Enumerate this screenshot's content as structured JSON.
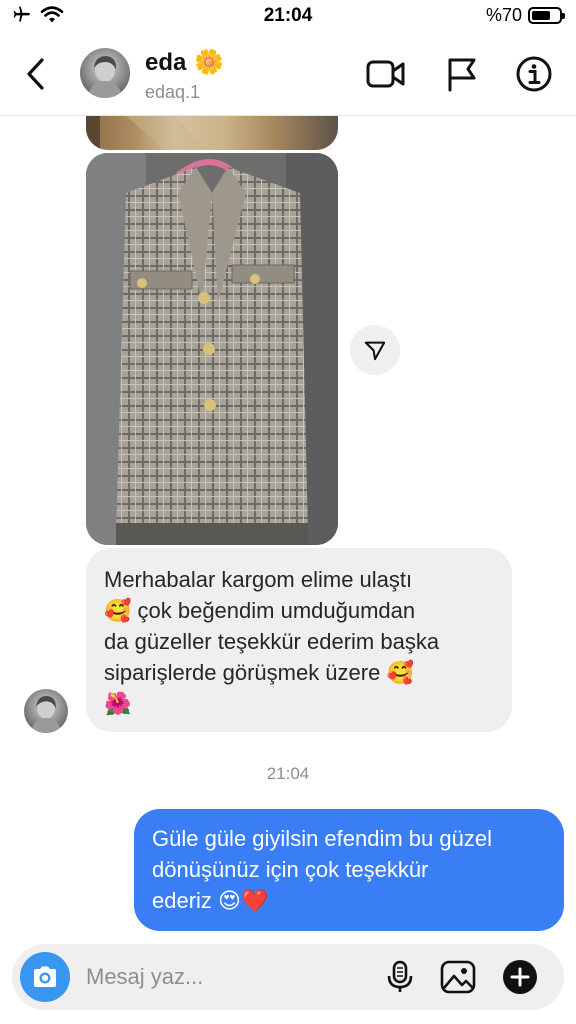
{
  "status_bar": {
    "time": "21:04",
    "battery_text": "%70",
    "battery_level": 0.7,
    "icons": [
      "airplane-icon",
      "wifi-icon",
      "battery-icon"
    ]
  },
  "header": {
    "name": "eda",
    "name_emoji": "🌼",
    "username": "edaq.1",
    "icons": [
      "back-icon",
      "video-call-icon",
      "flag-icon",
      "info-icon"
    ]
  },
  "messages": {
    "incoming": {
      "lines": [
        "Merhabalar kargom elime ulaştı",
        "🥰 çok beğendim umduğumdan",
        "da güzeller teşekkür ederim başka",
        "siparişlerde görüşmek üzere 🥰",
        "🌺"
      ]
    },
    "timestamp": "21:04",
    "outgoing": {
      "lines": [
        "Güle güle giyilsin efendim bu güzel",
        "dönüşünüz için çok teşekkür",
        "ederiz 😍❤️"
      ]
    }
  },
  "composer": {
    "placeholder": "Mesaj yaz...",
    "icons": [
      "camera-icon",
      "microphone-icon",
      "gallery-icon",
      "plus-icon"
    ]
  },
  "colors": {
    "outgoing_bubble": "#3a7ef6",
    "incoming_bubble": "#efefef",
    "camera_button": "#3897f0"
  }
}
